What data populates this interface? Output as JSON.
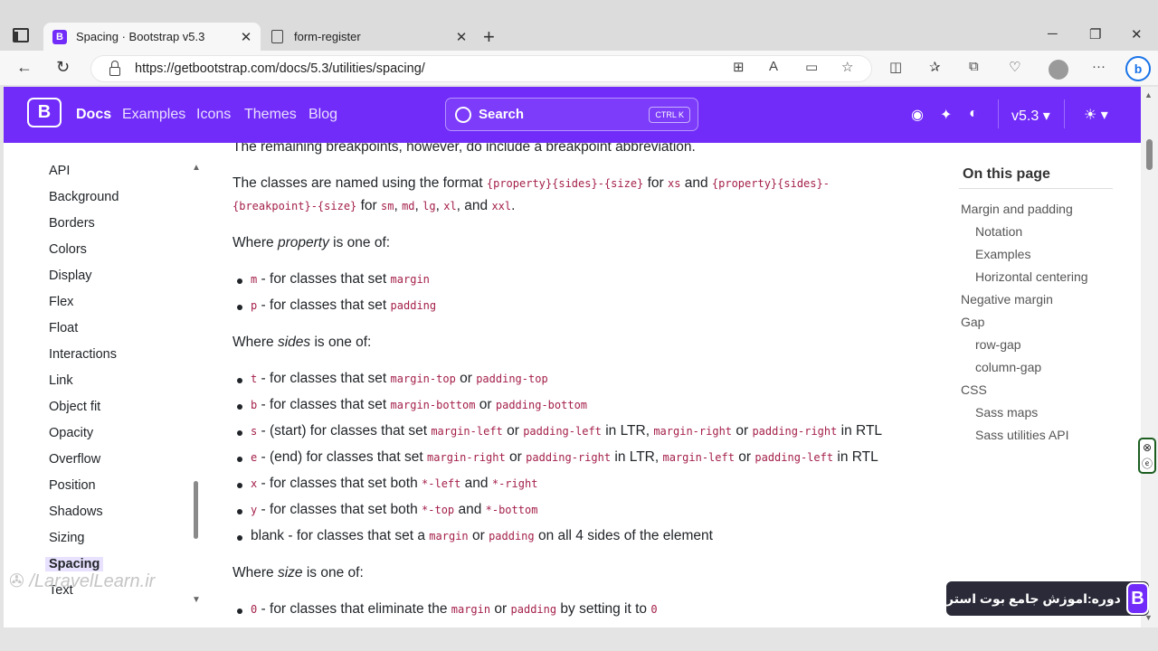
{
  "browser": {
    "tabs": [
      {
        "title": "Spacing · Bootstrap v5.3",
        "active": true
      },
      {
        "title": "form-register",
        "active": false
      }
    ],
    "new_tab": "+",
    "url": "https://getbootstrap.com/docs/5.3/utilities/spacing/",
    "window_controls": {
      "minimize": "─",
      "maximize": "❐",
      "close": "✕"
    },
    "back": "←",
    "reload": "↻",
    "bing": "b"
  },
  "site_nav": {
    "logo": "B",
    "links": [
      "Docs",
      "Examples",
      "Icons",
      "Themes",
      "Blog"
    ],
    "search_placeholder": "Search",
    "search_shortcut": "CTRL K",
    "version": "v5.3",
    "icons": [
      "github-icon",
      "twitter-icon",
      "opencollective-icon",
      "theme-sun-icon"
    ]
  },
  "sidebar": {
    "items": [
      "API",
      "Background",
      "Borders",
      "Colors",
      "Display",
      "Flex",
      "Float",
      "Interactions",
      "Link",
      "Object fit",
      "Opacity",
      "Overflow",
      "Position",
      "Shadows",
      "Sizing",
      "Spacing",
      "Text"
    ],
    "active": "Spacing"
  },
  "content": {
    "intro_line": "The remaining breakpoints, however, do include a breakpoint abbreviation.",
    "classes_named": {
      "t1": "The classes are named using the format ",
      "c1": "{property}{sides}-{size}",
      "t2": " for ",
      "c2": "xs",
      "t3": " and ",
      "c3": "{property}{sides}-",
      "c4": "{breakpoint}-{size}",
      "t4": " for ",
      "c5": "sm",
      "t5": ", ",
      "c6": "md",
      "t6": ", ",
      "c7": "lg",
      "t7": ", ",
      "c8": "xl",
      "t8": ", and ",
      "c9": "xxl",
      "t9": "."
    },
    "property_heading": {
      "pre": "Where ",
      "em": "property",
      "post": " is one of:"
    },
    "property_items": [
      {
        "code": "m",
        "text": " - for classes that set ",
        "code2": "margin"
      },
      {
        "code": "p",
        "text": " - for classes that set ",
        "code2": "padding"
      }
    ],
    "sides_heading": {
      "pre": "Where ",
      "em": "sides",
      "post": " is one of:"
    },
    "sides_items": {
      "t": {
        "code": "t",
        "text": " - for classes that set ",
        "c1": "margin-top",
        "or": " or ",
        "c2": "padding-top"
      },
      "b": {
        "code": "b",
        "text": " - for classes that set ",
        "c1": "margin-bottom",
        "or": " or ",
        "c2": "padding-bottom"
      },
      "s": {
        "code": "s",
        "text": " - (start) for classes that set ",
        "c1": "margin-left",
        "or": " or ",
        "c2": "padding-left",
        "mid": " in LTR, ",
        "c3": "margin-right",
        "or2": " or ",
        "c4": "padding-right",
        "end": " in RTL"
      },
      "e": {
        "code": "e",
        "text": " - (end) for classes that set ",
        "c1": "margin-right",
        "or": " or ",
        "c2": "padding-right",
        "mid": " in LTR, ",
        "c3": "margin-left",
        "or2": " or ",
        "c4": "padding-left",
        "end": " in RTL"
      },
      "x": {
        "code": "x",
        "text": " - for classes that set both ",
        "c1": "*-left",
        "and": " and ",
        "c2": "*-right"
      },
      "y": {
        "code": "y",
        "text": " - for classes that set both ",
        "c1": "*-top",
        "and": " and ",
        "c2": "*-bottom"
      },
      "blank": {
        "text": "blank - for classes that set a ",
        "c1": "margin",
        "or": " or ",
        "c2": "padding",
        "end": " on all 4 sides of the element"
      }
    },
    "size_heading": {
      "pre": "Where ",
      "em": "size",
      "post": " is one of:"
    },
    "size_item": {
      "code": "0",
      "text": " - for classes that eliminate the ",
      "c1": "margin",
      "or": " or ",
      "c2": "padding",
      "mid": " by setting it to ",
      "c3": "0"
    }
  },
  "toc": {
    "title": "On this page",
    "items": [
      "Margin and padding",
      "Notation",
      "Examples",
      "Horizontal centering",
      "Negative margin",
      "Gap",
      "row-gap",
      "column-gap",
      "CSS",
      "Sass maps",
      "Sass utilities API"
    ]
  },
  "overlay": {
    "watermark": "/LaravelLearn.ir",
    "banner_text": "دوره:اموزش جامع بوت استر",
    "banner_logo": "B"
  }
}
